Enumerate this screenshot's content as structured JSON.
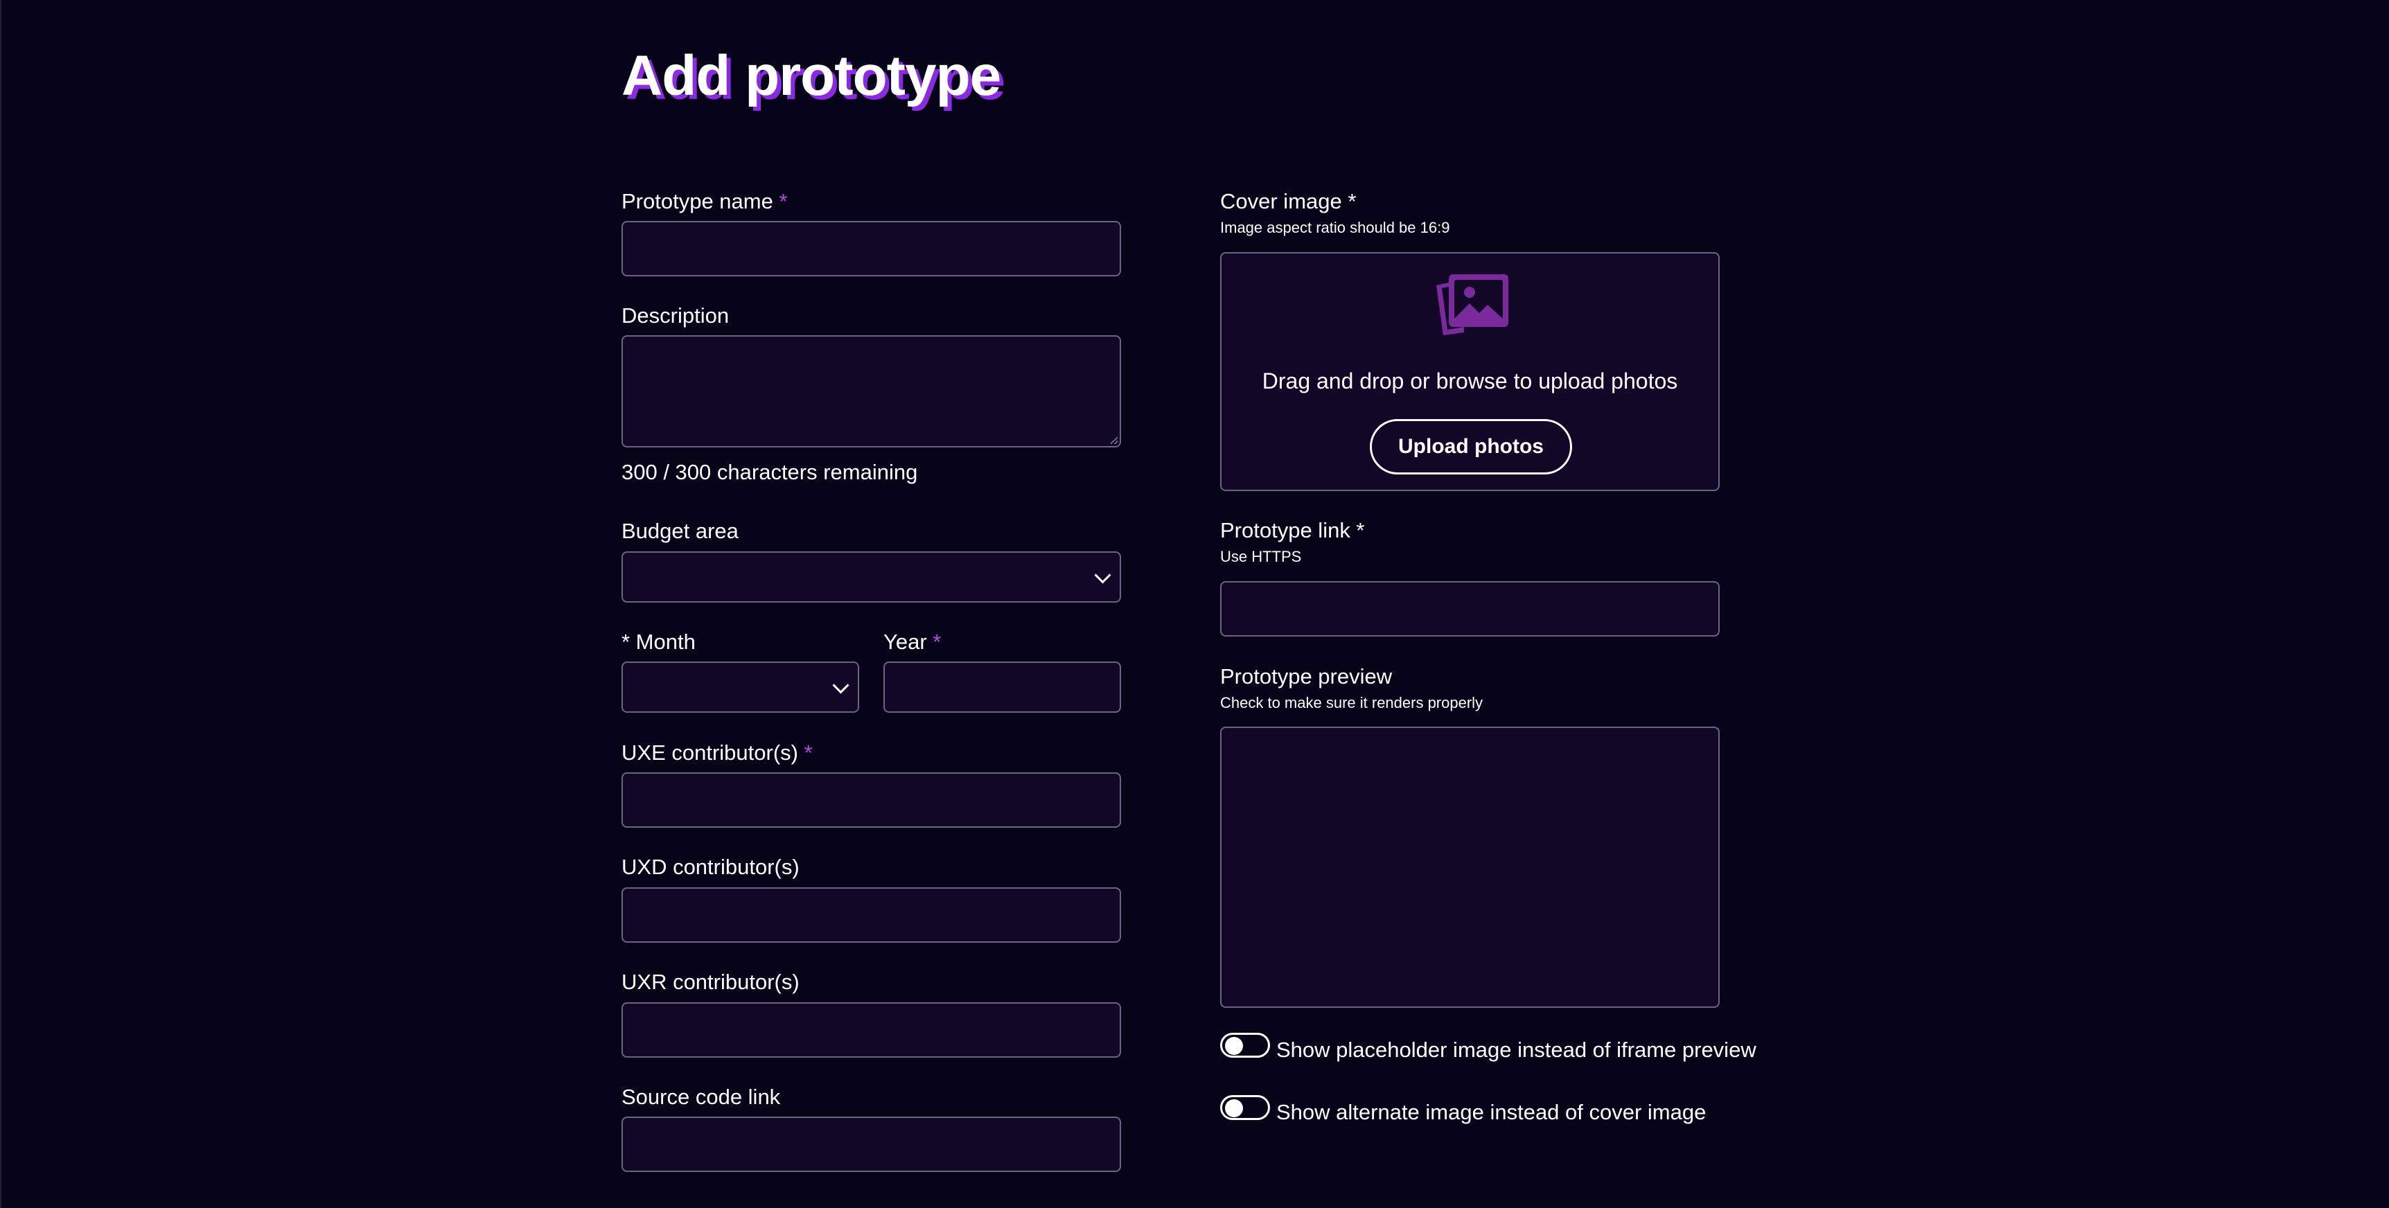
{
  "page": {
    "title": "Add prototype"
  },
  "form": {
    "prototype_name": {
      "label": "Prototype name",
      "required_mark": "*",
      "value": ""
    },
    "description": {
      "label": "Description",
      "value": "",
      "counter": "300 / 300 characters remaining"
    },
    "budget_area": {
      "label": "Budget area",
      "selected": ""
    },
    "month": {
      "label": "* Month",
      "selected": ""
    },
    "year": {
      "label": "Year",
      "required_mark": "*",
      "value": ""
    },
    "uxe": {
      "label": "UXE contributor(s)",
      "required_mark": "*",
      "value": ""
    },
    "uxd": {
      "label": "UXD contributor(s)",
      "value": ""
    },
    "uxr": {
      "label": "UXR contributor(s)",
      "value": ""
    },
    "source_code": {
      "label": "Source code link",
      "value": ""
    },
    "cover_image": {
      "label": "Cover image *",
      "hint": "Image aspect ratio should be 16:9",
      "drop_text": "Drag and drop or browse to upload photos",
      "upload_button": "Upload photos",
      "icon": "photos-icon"
    },
    "prototype_link": {
      "label": "Prototype link *",
      "hint": "Use HTTPS",
      "value": ""
    },
    "prototype_preview": {
      "label": "Prototype preview",
      "hint": "Check to make sure it renders properly"
    },
    "toggles": [
      {
        "label": "Show placeholder image instead of iframe preview",
        "on": false
      },
      {
        "label": "Show alternate image instead of cover image",
        "on": false
      }
    ]
  },
  "colors": {
    "background": "#07041a",
    "field_background": "#120727",
    "field_border": "#6a6580",
    "accent": "#8a2be2",
    "required": "#b04fd8",
    "icon": "#7b2a9c"
  }
}
